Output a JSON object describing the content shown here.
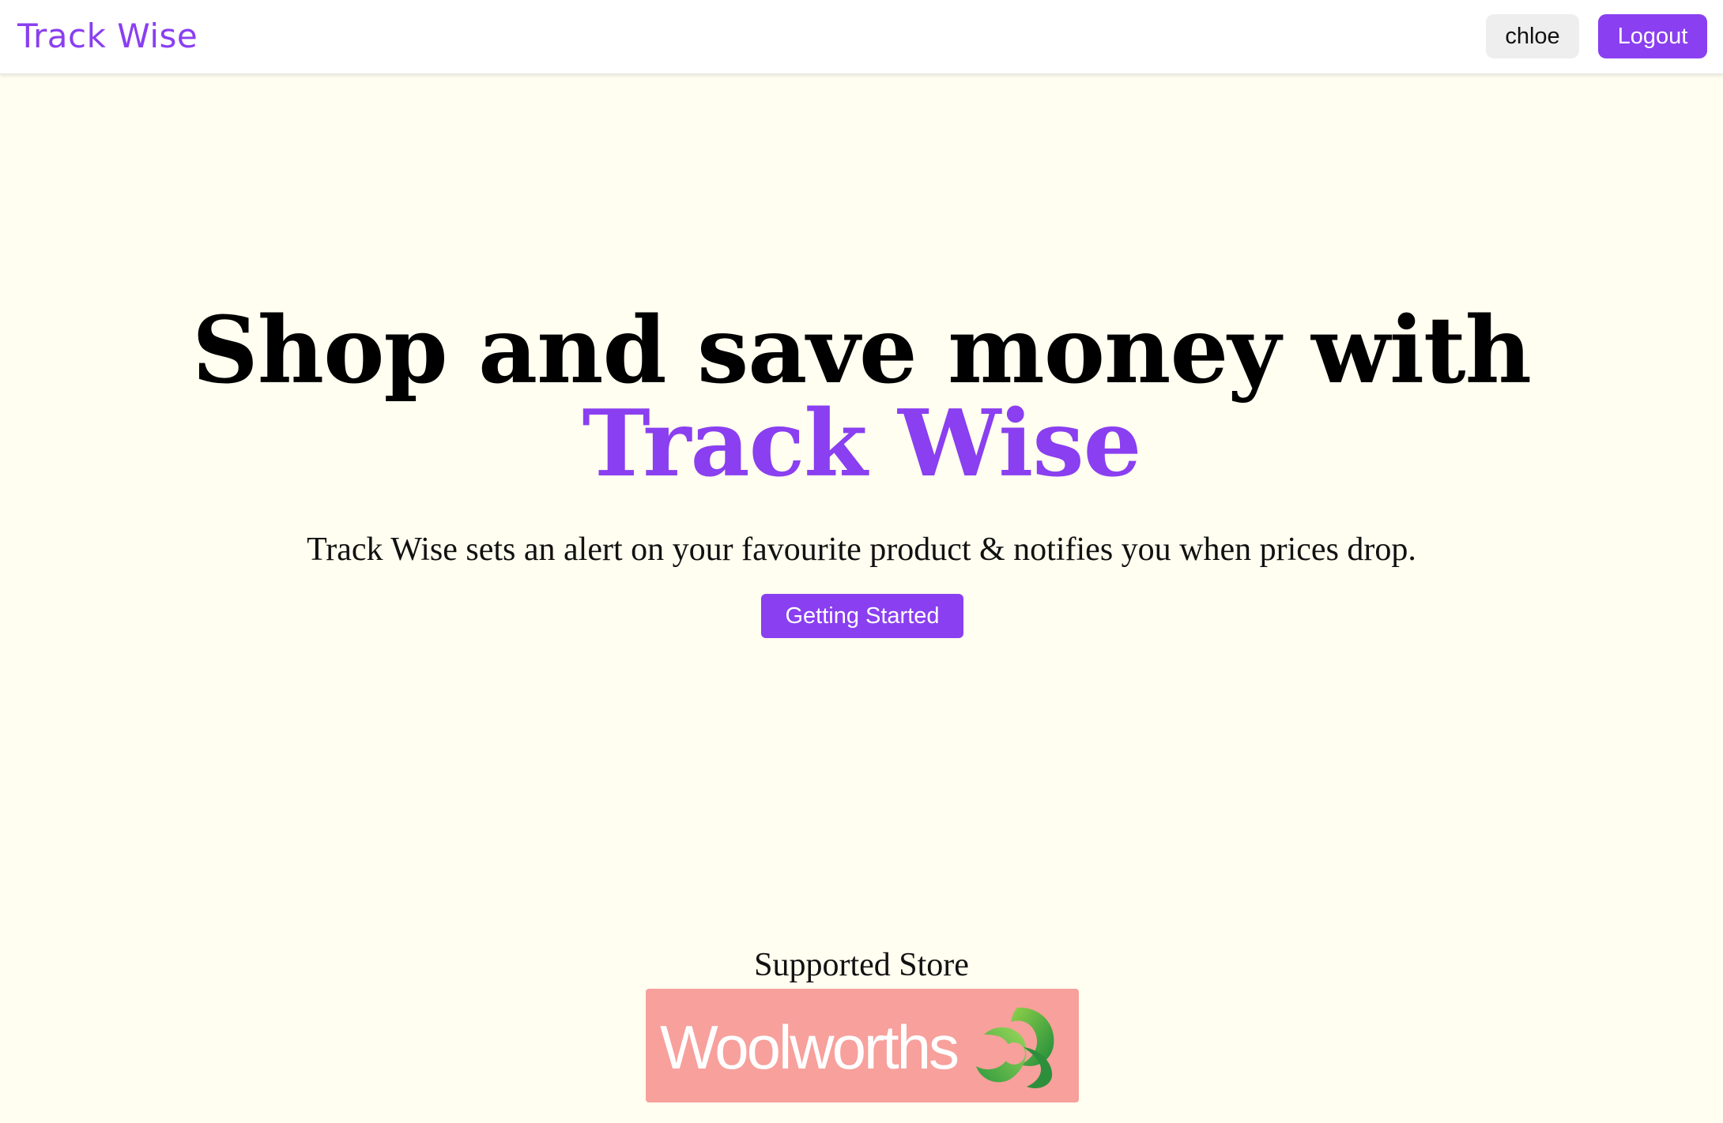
{
  "header": {
    "brand": "Track Wise",
    "user_label": "chloe",
    "logout_label": "Logout"
  },
  "hero": {
    "title_line1": "Shop and save money with",
    "title_line2": "Track Wise",
    "subtitle": "Track Wise sets an alert on your favourite product & notifies you when prices drop.",
    "cta_label": "Getting Started"
  },
  "stores": {
    "heading": "Supported Store",
    "items": [
      {
        "name": "Woolworths",
        "icon": "woolworths-logo-icon"
      }
    ]
  },
  "colors": {
    "accent": "#8a3ff0",
    "background": "#fffef0",
    "store_card": "#f7a09c",
    "logo_green": "#3aa44a"
  }
}
